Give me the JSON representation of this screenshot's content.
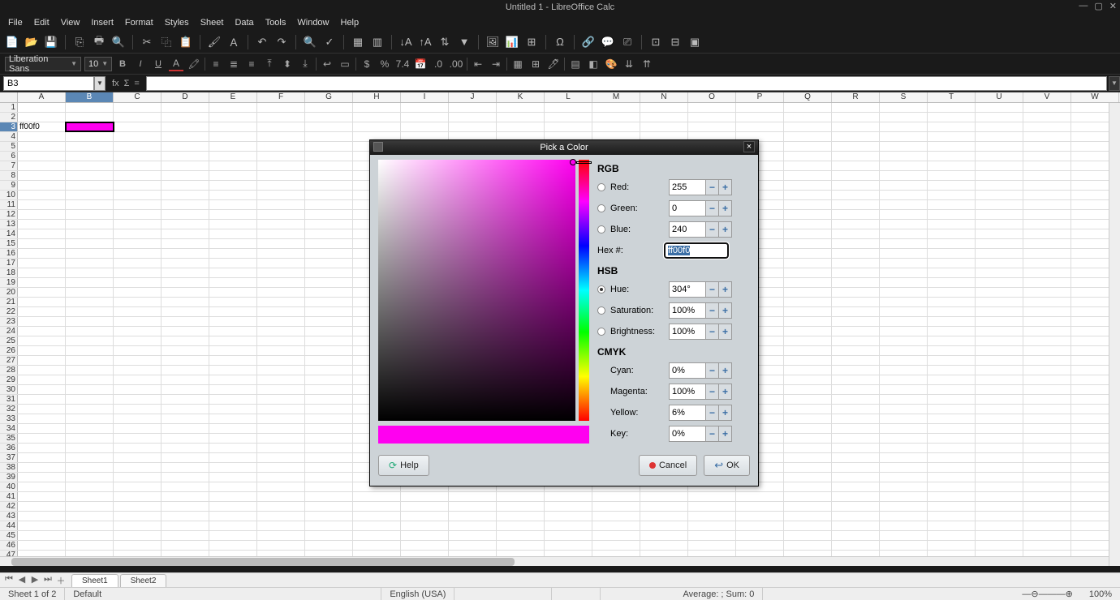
{
  "window": {
    "title": "Untitled 1 - LibreOffice Calc"
  },
  "menus": [
    "File",
    "Edit",
    "View",
    "Insert",
    "Format",
    "Styles",
    "Sheet",
    "Data",
    "Tools",
    "Window",
    "Help"
  ],
  "font": {
    "name": "Liberation Sans",
    "size": "10"
  },
  "namebox": "B3",
  "formula": "",
  "columns": [
    "A",
    "B",
    "C",
    "D",
    "E",
    "F",
    "G",
    "H",
    "I",
    "J",
    "K",
    "L",
    "M",
    "N",
    "O",
    "P",
    "Q",
    "R",
    "S",
    "T",
    "U",
    "V",
    "W"
  ],
  "selected_col": "B",
  "selected_row": 3,
  "cells": {
    "A3": "ff00f0"
  },
  "selected_cell_bg": "#ff00f0",
  "sheets": [
    "Sheet1",
    "Sheet2"
  ],
  "active_sheet": "Sheet1",
  "status": {
    "sheet": "Sheet 1 of 2",
    "style": "Default",
    "lang": "English (USA)",
    "avg": "Average: ; Sum: 0",
    "zoom": "100%"
  },
  "dialog": {
    "title": "Pick a Color",
    "rgb_label": "RGB",
    "hsb_label": "HSB",
    "cmyk_label": "CMYK",
    "red_label": "Red:",
    "green_label": "Green:",
    "blue_label": "Blue:",
    "hex_label": "Hex #:",
    "hue_label": "Hue:",
    "sat_label": "Saturation:",
    "bri_label": "Brightness:",
    "cyan_label": "Cyan:",
    "magenta_label": "Magenta:",
    "yellow_label": "Yellow:",
    "key_label": "Key:",
    "red": "255",
    "green": "0",
    "blue": "240",
    "hex": "ff00f0",
    "hue": "304°",
    "sat": "100%",
    "bri": "100%",
    "cyan": "0%",
    "magenta": "100%",
    "yellow": "6%",
    "key": "0%",
    "help": "Help",
    "cancel": "Cancel",
    "ok": "OK"
  }
}
